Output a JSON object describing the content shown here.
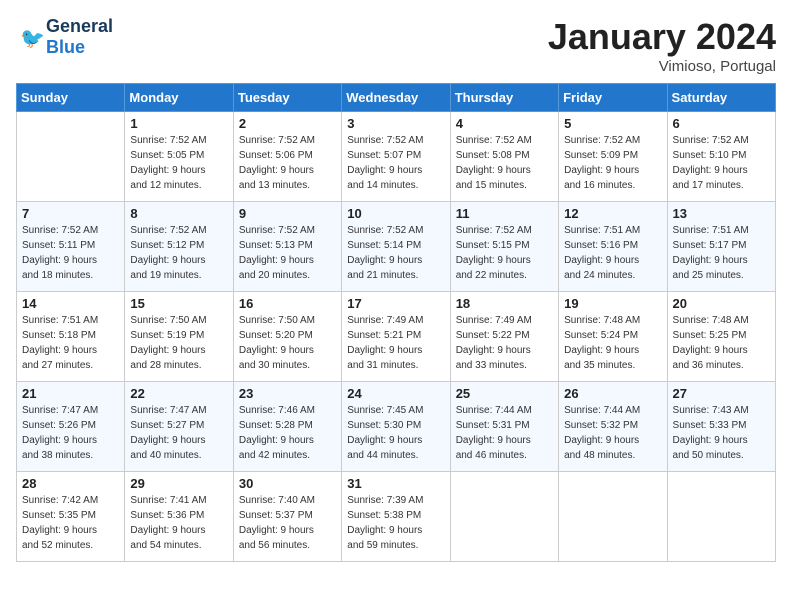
{
  "header": {
    "logo_general": "General",
    "logo_blue": "Blue",
    "month_title": "January 2024",
    "location": "Vimioso, Portugal"
  },
  "days_of_week": [
    "Sunday",
    "Monday",
    "Tuesday",
    "Wednesday",
    "Thursday",
    "Friday",
    "Saturday"
  ],
  "weeks": [
    [
      {
        "num": "",
        "info": ""
      },
      {
        "num": "1",
        "info": "Sunrise: 7:52 AM\nSunset: 5:05 PM\nDaylight: 9 hours\nand 12 minutes."
      },
      {
        "num": "2",
        "info": "Sunrise: 7:52 AM\nSunset: 5:06 PM\nDaylight: 9 hours\nand 13 minutes."
      },
      {
        "num": "3",
        "info": "Sunrise: 7:52 AM\nSunset: 5:07 PM\nDaylight: 9 hours\nand 14 minutes."
      },
      {
        "num": "4",
        "info": "Sunrise: 7:52 AM\nSunset: 5:08 PM\nDaylight: 9 hours\nand 15 minutes."
      },
      {
        "num": "5",
        "info": "Sunrise: 7:52 AM\nSunset: 5:09 PM\nDaylight: 9 hours\nand 16 minutes."
      },
      {
        "num": "6",
        "info": "Sunrise: 7:52 AM\nSunset: 5:10 PM\nDaylight: 9 hours\nand 17 minutes."
      }
    ],
    [
      {
        "num": "7",
        "info": "Sunrise: 7:52 AM\nSunset: 5:11 PM\nDaylight: 9 hours\nand 18 minutes."
      },
      {
        "num": "8",
        "info": "Sunrise: 7:52 AM\nSunset: 5:12 PM\nDaylight: 9 hours\nand 19 minutes."
      },
      {
        "num": "9",
        "info": "Sunrise: 7:52 AM\nSunset: 5:13 PM\nDaylight: 9 hours\nand 20 minutes."
      },
      {
        "num": "10",
        "info": "Sunrise: 7:52 AM\nSunset: 5:14 PM\nDaylight: 9 hours\nand 21 minutes."
      },
      {
        "num": "11",
        "info": "Sunrise: 7:52 AM\nSunset: 5:15 PM\nDaylight: 9 hours\nand 22 minutes."
      },
      {
        "num": "12",
        "info": "Sunrise: 7:51 AM\nSunset: 5:16 PM\nDaylight: 9 hours\nand 24 minutes."
      },
      {
        "num": "13",
        "info": "Sunrise: 7:51 AM\nSunset: 5:17 PM\nDaylight: 9 hours\nand 25 minutes."
      }
    ],
    [
      {
        "num": "14",
        "info": "Sunrise: 7:51 AM\nSunset: 5:18 PM\nDaylight: 9 hours\nand 27 minutes."
      },
      {
        "num": "15",
        "info": "Sunrise: 7:50 AM\nSunset: 5:19 PM\nDaylight: 9 hours\nand 28 minutes."
      },
      {
        "num": "16",
        "info": "Sunrise: 7:50 AM\nSunset: 5:20 PM\nDaylight: 9 hours\nand 30 minutes."
      },
      {
        "num": "17",
        "info": "Sunrise: 7:49 AM\nSunset: 5:21 PM\nDaylight: 9 hours\nand 31 minutes."
      },
      {
        "num": "18",
        "info": "Sunrise: 7:49 AM\nSunset: 5:22 PM\nDaylight: 9 hours\nand 33 minutes."
      },
      {
        "num": "19",
        "info": "Sunrise: 7:48 AM\nSunset: 5:24 PM\nDaylight: 9 hours\nand 35 minutes."
      },
      {
        "num": "20",
        "info": "Sunrise: 7:48 AM\nSunset: 5:25 PM\nDaylight: 9 hours\nand 36 minutes."
      }
    ],
    [
      {
        "num": "21",
        "info": "Sunrise: 7:47 AM\nSunset: 5:26 PM\nDaylight: 9 hours\nand 38 minutes."
      },
      {
        "num": "22",
        "info": "Sunrise: 7:47 AM\nSunset: 5:27 PM\nDaylight: 9 hours\nand 40 minutes."
      },
      {
        "num": "23",
        "info": "Sunrise: 7:46 AM\nSunset: 5:28 PM\nDaylight: 9 hours\nand 42 minutes."
      },
      {
        "num": "24",
        "info": "Sunrise: 7:45 AM\nSunset: 5:30 PM\nDaylight: 9 hours\nand 44 minutes."
      },
      {
        "num": "25",
        "info": "Sunrise: 7:44 AM\nSunset: 5:31 PM\nDaylight: 9 hours\nand 46 minutes."
      },
      {
        "num": "26",
        "info": "Sunrise: 7:44 AM\nSunset: 5:32 PM\nDaylight: 9 hours\nand 48 minutes."
      },
      {
        "num": "27",
        "info": "Sunrise: 7:43 AM\nSunset: 5:33 PM\nDaylight: 9 hours\nand 50 minutes."
      }
    ],
    [
      {
        "num": "28",
        "info": "Sunrise: 7:42 AM\nSunset: 5:35 PM\nDaylight: 9 hours\nand 52 minutes."
      },
      {
        "num": "29",
        "info": "Sunrise: 7:41 AM\nSunset: 5:36 PM\nDaylight: 9 hours\nand 54 minutes."
      },
      {
        "num": "30",
        "info": "Sunrise: 7:40 AM\nSunset: 5:37 PM\nDaylight: 9 hours\nand 56 minutes."
      },
      {
        "num": "31",
        "info": "Sunrise: 7:39 AM\nSunset: 5:38 PM\nDaylight: 9 hours\nand 59 minutes."
      },
      {
        "num": "",
        "info": ""
      },
      {
        "num": "",
        "info": ""
      },
      {
        "num": "",
        "info": ""
      }
    ]
  ]
}
